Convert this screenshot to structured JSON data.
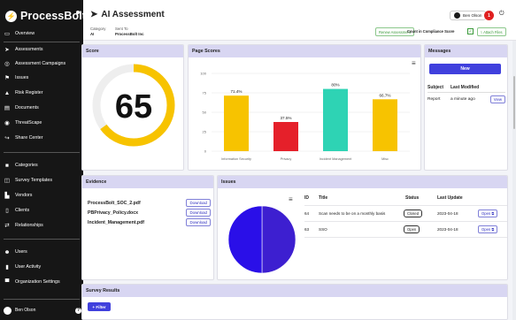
{
  "app": {
    "name": "ProcessBolt"
  },
  "sidebar": {
    "items": [
      {
        "label": "Overview",
        "icon": "monitor-icon"
      },
      {
        "label": "Assessments",
        "icon": "send-icon"
      },
      {
        "label": "Assessment Campaigns",
        "icon": "target-icon"
      },
      {
        "label": "Issues",
        "icon": "flag-icon"
      },
      {
        "label": "Risk Register",
        "icon": "warning-icon"
      },
      {
        "label": "Documents",
        "icon": "document-icon"
      },
      {
        "label": "ThreatScape",
        "icon": "eye-icon"
      },
      {
        "label": "Share Center",
        "icon": "share-icon"
      },
      {
        "label": "Categories",
        "icon": "folder-icon"
      },
      {
        "label": "Survey Templates",
        "icon": "template-icon"
      },
      {
        "label": "Vendors",
        "icon": "factory-icon"
      },
      {
        "label": "Clients",
        "icon": "client-icon"
      },
      {
        "label": "Relationships",
        "icon": "arrows-icon"
      },
      {
        "label": "Users",
        "icon": "users-icon"
      },
      {
        "label": "User Activity",
        "icon": "activity-icon"
      },
      {
        "label": "Organization Settings",
        "icon": "building-icon"
      }
    ],
    "user": "Ben Olson"
  },
  "header": {
    "title": "AI Assessment",
    "category_label": "Category",
    "category_value": "AI",
    "sent_to_label": "Sent To",
    "sent_to_value": "ProcessBolt Inc",
    "user": "Ben Olson",
    "notifications": "1",
    "review_label": "Renew Assessment",
    "compliance_label": "Count in Compliance Score",
    "attach_label": "Attach Files"
  },
  "score": {
    "title": "Score",
    "value": "65",
    "ring_fraction": 0.65,
    "ring_color": "#f7c300",
    "track_color": "#eeeeee"
  },
  "page_scores": {
    "title": "Page Scores",
    "chart_data": {
      "type": "bar",
      "categories": [
        "Information Security",
        "Privacy",
        "Incident Management",
        "Misc"
      ],
      "values": [
        71.4,
        37.5,
        80,
        66.7
      ],
      "data_labels": [
        "71.4%",
        "37.5%",
        "80%",
        "66.7%"
      ],
      "colors": [
        "#f7c300",
        "#e5202a",
        "#2ed3b4",
        "#f7c300"
      ],
      "ylim": [
        0,
        100
      ],
      "yticks": [
        "0",
        "25",
        "50",
        "75",
        "100"
      ]
    }
  },
  "messages": {
    "title": "Messages",
    "new_label": "New",
    "col_subject": "Subject",
    "col_modified": "Last Modified",
    "rows": [
      {
        "subject": "Report",
        "modified": "a minute ago",
        "action": "View"
      }
    ]
  },
  "evidence": {
    "title": "Evidence",
    "files": [
      {
        "name": "ProcessBolt_SOC_2.pdf",
        "action": "Download"
      },
      {
        "name": "PBPrivacy_Policy.docx",
        "action": "Download"
      },
      {
        "name": "Incident_Management.pdf",
        "action": "Download"
      }
    ]
  },
  "issues": {
    "title": "Issues",
    "pie": {
      "slices": [
        {
          "value": 1,
          "color": "#3d1fd0"
        },
        {
          "value": 1,
          "color": "#2a0fe8"
        }
      ]
    },
    "cols": {
      "id": "ID",
      "title": "Title",
      "status": "Status",
      "updated": "Last Update"
    },
    "rows": [
      {
        "id": "64",
        "title": "Scan needs to be on a monthly basis",
        "status": "Closed",
        "updated": "2023-04-18",
        "action": "Open"
      },
      {
        "id": "63",
        "title": "SSO",
        "status": "Open",
        "updated": "2023-04-18",
        "action": "Open"
      }
    ]
  },
  "survey": {
    "title": "Survey Results",
    "filter_label": "Filter"
  }
}
